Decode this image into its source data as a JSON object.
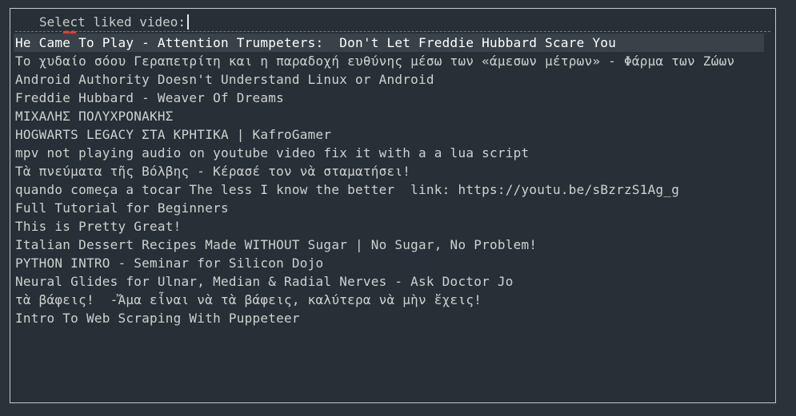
{
  "prompt": {
    "icon": "heart-icon",
    "label": "Select liked video:"
  },
  "colors": {
    "heart": "#e53935",
    "background": "#2b3339",
    "menu_background": "#273036",
    "selected_background": "#384248",
    "border": "#c4cac7"
  },
  "items": [
    "He Came To Play - Attention Trumpeters:  Don't Let Freddie Hubbard Scare You",
    "Το χυδαίο σόου Γεραπετρίτη και η παραδοχή ευθύνης μέσω των «άμεσων μέτρων» - Φάρμα των Ζώων",
    "Android Authority Doesn't Understand Linux or Android",
    "Freddie Hubbard - Weaver Of Dreams",
    "ΜΙΧΑΛΗΣ ΠΟΛΥΧΡΟΝΑΚΗΣ",
    "HOGWARTS LEGACY ΣΤΑ ΚΡΗΤΙΚΑ | KafroGamer",
    "mpv not playing audio on youtube video fix it with a a lua script",
    "Τὰ πνεύματα τῆς Βόλβης - Κέρασέ τον νὰ σταματήσει!",
    "quando começa a tocar The less I know the better  link: https://youtu.be/sBzrzS1Ag_g",
    "Full Tutorial for Beginners",
    "This is Pretty Great!",
    "Italian Dessert Recipes Made WITHOUT Sugar | No Sugar, No Problem!",
    "PYTHON INTRO - Seminar for Silicon Dojo",
    "Neural Glides for Ulnar, Median & Radial Nerves - Ask Doctor Jo",
    "τὰ βάφεις!  -Ἄμα εἶναι νὰ τὰ βάφεις, καλύτερα νὰ μὴν ἔχεις!",
    "Intro To Web Scraping With Puppeteer"
  ],
  "selected_index": 0
}
